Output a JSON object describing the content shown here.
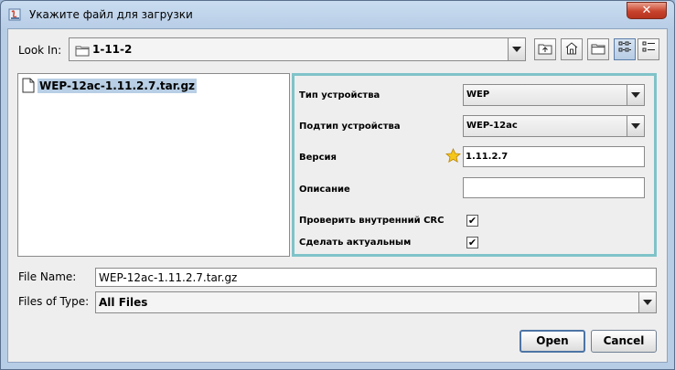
{
  "window": {
    "title": "Укажите файл для загрузки",
    "close_label": "✕"
  },
  "look_in": {
    "label": "Look In:",
    "value": "1-11-2"
  },
  "toolbar": {
    "icons": [
      "up-one-level-icon",
      "home-icon",
      "new-folder-icon",
      "list-view-icon",
      "details-view-icon"
    ]
  },
  "file_list": {
    "items": [
      {
        "name": "WEP-12ac-1.11.2.7.tar.gz",
        "selected": true
      }
    ]
  },
  "accessory": {
    "device_type": {
      "label": "Тип устройства",
      "value": "WEP"
    },
    "device_subtype": {
      "label": "Подтип устройства",
      "value": "WEP-12ac"
    },
    "version": {
      "label": "Версия",
      "value": "1.11.2.7",
      "icon": "star-icon"
    },
    "description": {
      "label": "Описание",
      "value": ""
    },
    "check_crc": {
      "label": "Проверить внутренний CRC",
      "checked": true,
      "mark": "✔"
    },
    "make_current": {
      "label": "Сделать актуальным",
      "checked": true,
      "mark": "✔"
    }
  },
  "file_name": {
    "label": "File Name:",
    "value": "WEP-12ac-1.11.2.7.tar.gz"
  },
  "files_of_type": {
    "label": "Files of Type:",
    "value": "All Files"
  },
  "buttons": {
    "open": "Open",
    "cancel": "Cancel"
  },
  "colors": {
    "accessory_border": "#7fc3c9",
    "selection": "#b8cfe5",
    "close_button": "#c8432c"
  }
}
